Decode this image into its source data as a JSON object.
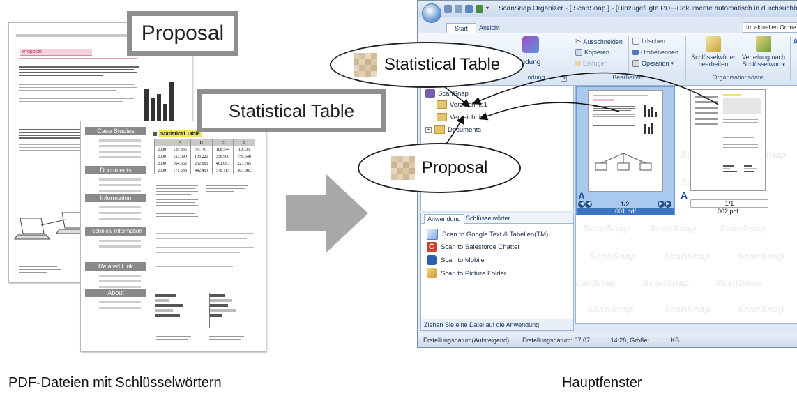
{
  "left_docs": {
    "proposal_label": "Proposal",
    "proposal_heading": "Proposal",
    "statistical_label": "Statistical Table",
    "side_buttons": [
      "Case Studies",
      "Documents",
      "Information",
      "Technical Information",
      "Related Link",
      "About"
    ],
    "table_title": "Statistical Table",
    "table_header": [
      "",
      "A",
      "B",
      "C",
      "D"
    ],
    "table_rows": [
      [
        "2000",
        "129,335",
        "95,191",
        "108,544",
        "19,335"
      ],
      [
        "2000",
        "153,090",
        "103,221",
        "356,900",
        "756,540"
      ],
      [
        "2000",
        "164,552",
        "252,665",
        "401,063",
        "223,785"
      ],
      [
        "2000",
        "171,538",
        "442,453",
        "578,115",
        "303,002"
      ]
    ]
  },
  "window": {
    "title": "ScanSnap Organizer - [ ScanSnap ] - [Hinzugefügte PDF-Dokumente automatisch in durchsuchbare PD",
    "tabs": [
      "Start",
      "Ansicht"
    ],
    "search_scope": "Im aktuellen Ordne",
    "ribbon": {
      "partial_label": "endung",
      "cut": "Ausschneiden",
      "copy": "Kopieren",
      "paste": "Einfügen",
      "delete": "Löschen",
      "rename": "Umbenennen",
      "operation": "Operation",
      "edit_keywords_1": "Schlüsselwörter",
      "edit_keywords_2": "bearbeiten",
      "distribute_1": "Verteilung nach",
      "distribute_2": "Schlüsselwort",
      "group_left": "ndung",
      "group_edit": "Bearbeiten",
      "group_org": "Organisationsdatei"
    },
    "tree": {
      "root": "ScanSnap",
      "folder1": "Verzeichnis1",
      "folder2": "Verzeichnis",
      "folder3": "Documents"
    },
    "files": [
      {
        "page": "1/2",
        "name": "001.pdf"
      },
      {
        "page": "1/1",
        "name": "002.pdf"
      }
    ],
    "app_tabs": [
      "Anwendung",
      "Schlüsselwörter"
    ],
    "apps": [
      "Scan to Google Text & Tabellen(TM)",
      "Scan to Salesforce Chatter",
      "Scan to Mobile",
      "Scan to Picture Folder"
    ],
    "drop_hint": "Ziehen Sie eine Datei auf die Anwendung.",
    "status": {
      "sort": "Erstellungsdatum(Aufsteigend)",
      "created": "Erstellungsdatum: 07.07.",
      "created_time": "14:28, Größe:",
      "size_unit": "KB"
    },
    "watermark": "ScanSnap"
  },
  "bubbles": {
    "statistical": "Statistical Table",
    "proposal": "Proposal"
  },
  "captions": {
    "left": "PDF-Dateien mit Schlüsselwörtern",
    "right": "Hauptfenster"
  },
  "colors": {
    "ribbon_bg": "#dfe9f5",
    "frame_gray": "#8e8e8e",
    "selection_blue": "#a9c9ee",
    "link_blue": "#1f4e8c",
    "arrow_gray": "#a8a8a8"
  }
}
